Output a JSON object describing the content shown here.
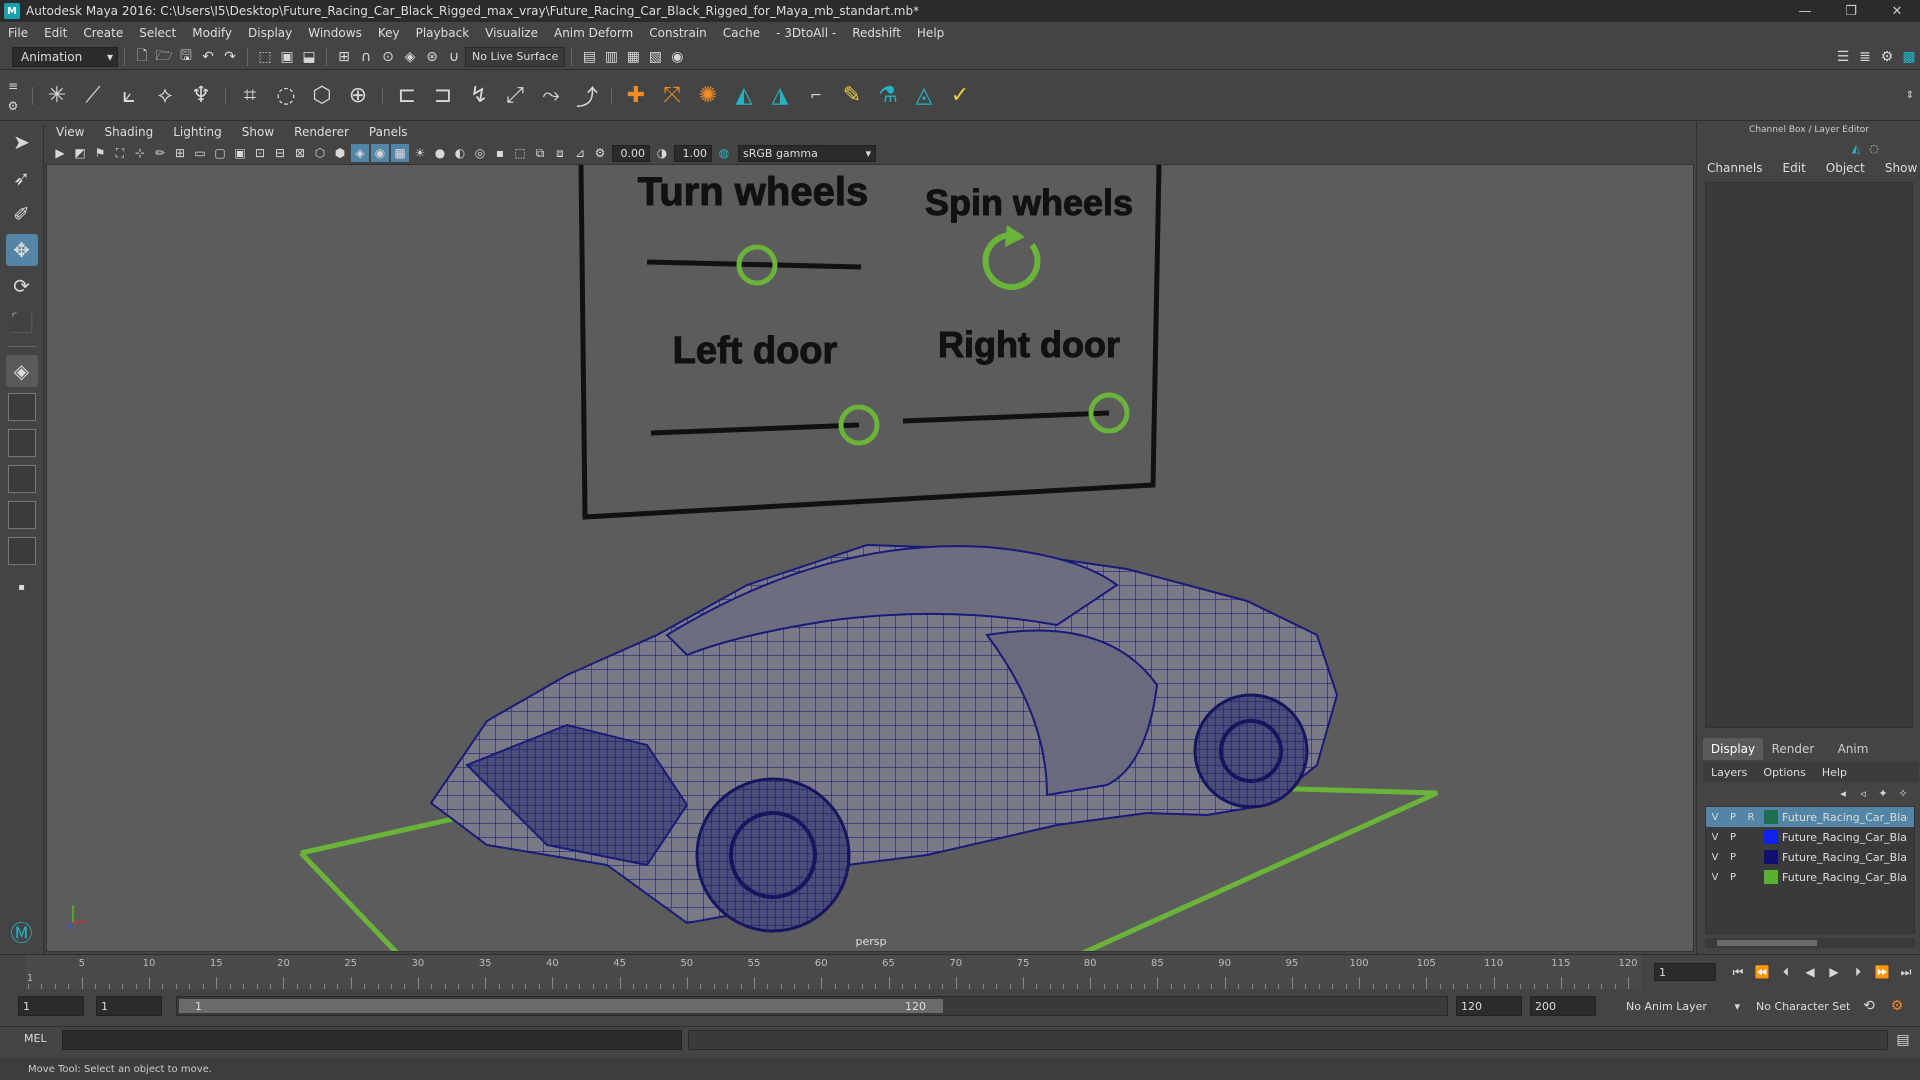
{
  "window": {
    "title": "Autodesk Maya 2016: C:\\Users\\I5\\Desktop\\Future_Racing_Car_Black_Rigged_max_vray\\Future_Racing_Car_Black_Rigged_for_Maya_mb_standart.mb*",
    "minimize": "—",
    "maximize": "❐",
    "close": "✕"
  },
  "menubar": [
    "File",
    "Edit",
    "Create",
    "Select",
    "Modify",
    "Display",
    "Windows",
    "Key",
    "Playback",
    "Visualize",
    "Anim Deform",
    "Constrain",
    "Cache",
    "- 3DtoAll -",
    "Redshift",
    "Help"
  ],
  "statusline": {
    "mode": "Animation",
    "live_surface": "No Live Surface"
  },
  "panel": {
    "menus": [
      "View",
      "Shading",
      "Lighting",
      "Show",
      "Renderer",
      "Panels"
    ],
    "exposure": "0.00",
    "gamma_value": "1.00",
    "color_space": "sRGB gamma"
  },
  "viewport": {
    "camera": "persp",
    "rig_labels": {
      "turn_wheels": "Turn wheels",
      "spin_wheels": "Spin wheels",
      "left_door": "Left door",
      "right_door": "Right door"
    },
    "wire_color": "#1a1a7a",
    "control_color": "#6bb43a"
  },
  "right_panel": {
    "title": "Channel Box / Layer Editor",
    "menus": [
      "Channels",
      "Edit",
      "Object",
      "Show"
    ],
    "tabs": [
      "Display",
      "Render",
      "Anim"
    ],
    "layer_menus": [
      "Layers",
      "Options",
      "Help"
    ],
    "layers": [
      {
        "v": "V",
        "p": "P",
        "r": "R",
        "name": "Future_Racing_Car_Black",
        "color": "#1e6e50",
        "selected": true
      },
      {
        "v": "V",
        "p": "P",
        "r": "",
        "name": "Future_Racing_Car_Bla",
        "color": "#1020ee",
        "selected": false
      },
      {
        "v": "V",
        "p": "P",
        "r": "",
        "name": "Future_Racing_Car_Bla",
        "color": "#101070",
        "selected": false
      },
      {
        "v": "V",
        "p": "P",
        "r": "",
        "name": "Future_Racing_Car_Bla",
        "color": "#5ab030",
        "selected": false
      }
    ]
  },
  "timeline": {
    "ticks": [
      "5",
      "10",
      "15",
      "20",
      "25",
      "30",
      "35",
      "40",
      "45",
      "50",
      "55",
      "60",
      "65",
      "70",
      "75",
      "80",
      "85",
      "90",
      "95",
      "100",
      "105",
      "110",
      "115",
      "120"
    ],
    "start_mark": "1",
    "current_frame": "1"
  },
  "range": {
    "start": "1",
    "anim_start": "1",
    "slider_start": "1",
    "slider_end": "120",
    "end": "120",
    "anim_end": "200",
    "anim_layer": "No Anim Layer",
    "character_set": "No Character Set"
  },
  "cmdline": {
    "label": "MEL"
  },
  "helpline": {
    "text": "Move Tool: Select an object to move."
  }
}
